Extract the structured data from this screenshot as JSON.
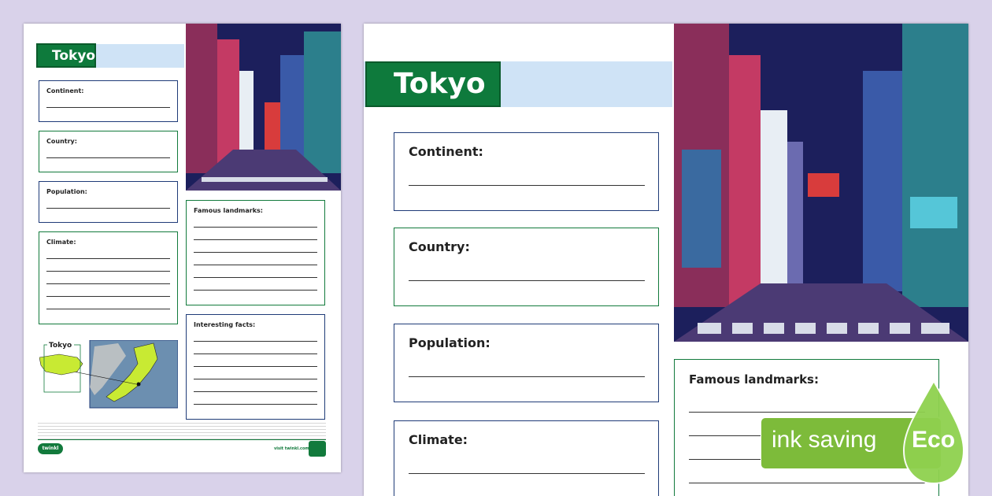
{
  "title": "Tokyo",
  "fields": {
    "continent": "Continent:",
    "country": "Country:",
    "population": "Population:",
    "climate": "Climate:",
    "landmarks": "Famous landmarks:",
    "facts": "Interesting facts:"
  },
  "map_label": "Tokyo",
  "small_footer_url": "visit twinkl.com",
  "brand": "twinkl",
  "badge": {
    "text": "ink saving",
    "eco": "Eco"
  },
  "colors": {
    "background": "#d9d2ea",
    "title_green": "#0e7a3c",
    "title_blue": "#cfe3f6",
    "border_blue": "#1f3b78",
    "border_green": "#127a3c",
    "eco_green": "#7dbb3a"
  },
  "icons": [
    "city-illustration",
    "japan-map",
    "tokyo-map",
    "water-drop-icon"
  ]
}
